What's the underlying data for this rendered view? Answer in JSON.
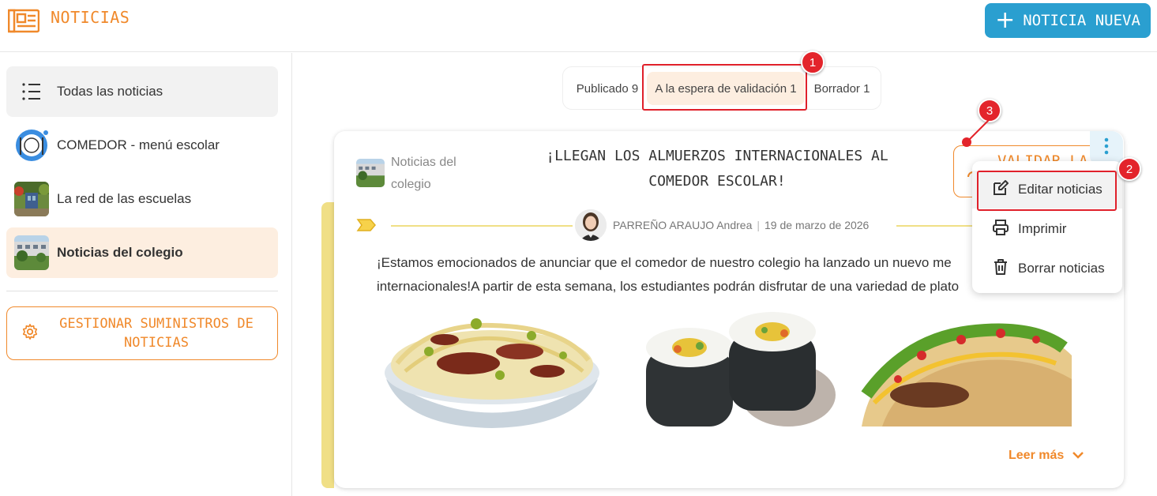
{
  "header": {
    "app_title": "NOTICIAS",
    "new_button_label": "NOTICIA NUEVA",
    "icon": "newspaper-icon"
  },
  "sidebar": {
    "items": [
      {
        "label": "Todas las noticias",
        "icon": "list-icon"
      },
      {
        "label": "COMEDOR - menú escolar",
        "icon": "plate-icon"
      },
      {
        "label": "La red de las escuelas",
        "icon": "school-thumbnail"
      },
      {
        "label": "Noticias del colegio",
        "icon": "building-thumbnail",
        "selected": true
      }
    ],
    "manage_button_label": "GESTIONAR SUMINISTROS DE NOTICIAS"
  },
  "tabs": [
    {
      "label": "Publicado 9"
    },
    {
      "label": "A la espera de validación 1",
      "active": true
    },
    {
      "label": "Borrador 1"
    }
  ],
  "annotations": [
    "1",
    "2",
    "3"
  ],
  "news": {
    "source": "Noticias del colegio",
    "title": "¡LLEGAN LOS ALMUERZOS INTERNACIONALES AL COMEDOR ESCOLAR!",
    "validate_label": "VALIDAR LA",
    "author": "PARREÑO ARAUJO Andrea",
    "date": "19 de marzo de 2026",
    "body_line1": "¡Estamos emocionados de anunciar que el comedor de nuestro colegio ha lanzado un nuevo me",
    "body_line2": "internacionales!A partir de esta semana, los estudiantes podrán disfrutar de una variedad de plato",
    "images": [
      "pasta-image",
      "sushi-image",
      "taco-image"
    ],
    "read_more": "Leer más"
  },
  "menu": {
    "items": [
      {
        "label": "Editar noticias",
        "icon": "edit-icon"
      },
      {
        "label": "Imprimir",
        "icon": "printer-icon"
      },
      {
        "label": "Borrar noticias",
        "icon": "trash-icon"
      }
    ]
  },
  "colors": {
    "accent": "#f0892b",
    "primary": "#2a9fd0",
    "selected_bg": "#fdeee0",
    "annotation_red": "#e3242b",
    "card_bar": "#f0df86"
  }
}
